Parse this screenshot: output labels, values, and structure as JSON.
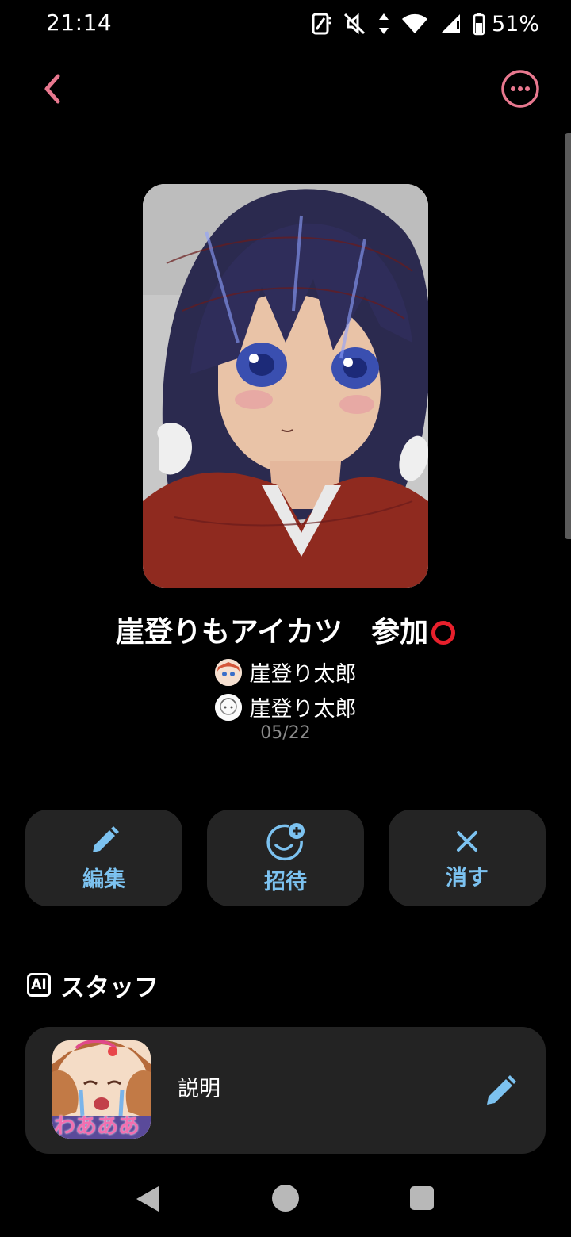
{
  "status_bar": {
    "time": "21:14",
    "battery_percent": "51%",
    "icons": [
      "screen-rotate-icon",
      "mute-icon",
      "data-arrows-icon",
      "wifi-icon",
      "signal-icon",
      "battery-icon"
    ]
  },
  "nav": {
    "back_icon": "chevron-left-icon",
    "more_icon": "more-horizontal-icon",
    "accent_color": "#e8788f"
  },
  "post": {
    "title": "崖登りもアイカツ　参加",
    "title_mark_icon": "red-circle-icon",
    "authors": [
      {
        "name": "崖登り太郎",
        "avatar_icon": "avatar-icon"
      },
      {
        "name": "崖登り太郎",
        "avatar_icon": "avatar-icon"
      }
    ],
    "date": "05/22"
  },
  "actions": [
    {
      "label": "編集",
      "icon": "pencil-icon"
    },
    {
      "label": "招待",
      "icon": "smile-add-icon"
    },
    {
      "label": "消す",
      "icon": "close-icon"
    }
  ],
  "staff": {
    "badge": "AI",
    "title": "スタッフ",
    "card": {
      "description": "説明",
      "thumb_text": "わあああ",
      "edit_icon": "pencil-icon"
    }
  },
  "system_nav": [
    "nav-back-icon",
    "nav-home-icon",
    "nav-recents-icon"
  ],
  "colors": {
    "action_text": "#7cc2f0",
    "card_bg": "#242424",
    "title_mark": "#e8202c"
  }
}
